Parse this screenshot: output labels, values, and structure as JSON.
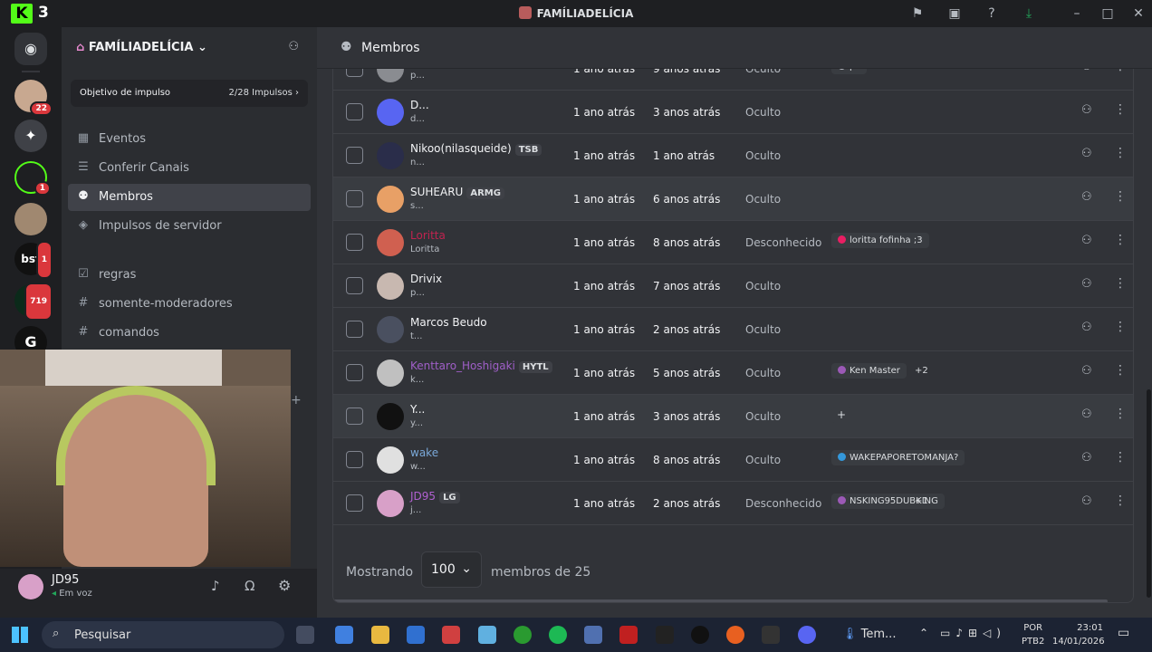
{
  "titlebar": {
    "app_logo": "K",
    "app_tab_number": "3",
    "server_title": "FAMÍLIADELÍCIA"
  },
  "servers": {
    "badges": [
      "22",
      "1",
      "1",
      "719"
    ]
  },
  "sidebar": {
    "server_name": "FAMÍLIADELÍCIA",
    "boost_goal_label": "Objetivo de impulso",
    "boost_count": "2/28 Impulsos",
    "items": [
      {
        "label": "Eventos",
        "icon": "calendar-icon"
      },
      {
        "label": "Conferir Canais",
        "icon": "list-icon"
      },
      {
        "label": "Membros",
        "icon": "members-icon"
      },
      {
        "label": "Impulsos de servidor",
        "icon": "boost-icon"
      }
    ],
    "channels": [
      {
        "label": "regras",
        "icon": "rules-icon"
      },
      {
        "label": "somente-moderadores",
        "icon": "hash-icon"
      },
      {
        "label": "comandos",
        "icon": "hash-icon"
      }
    ]
  },
  "user": {
    "name": "JD95",
    "status": "Em voz"
  },
  "main": {
    "title": "Membros"
  },
  "members": [
    {
      "name": "",
      "sub": "p...",
      "col1": "1 ano atrás",
      "col2": "9 anos atrás",
      "col3": "Oculto",
      "role": "po",
      "role_color": "#b5bac1",
      "extra": "",
      "name_color": "#f2f3f5",
      "tag": "",
      "av": "#8a8c91"
    },
    {
      "name": "D...",
      "sub": "d...",
      "col1": "1 ano atrás",
      "col2": "3 anos atrás",
      "col3": "Oculto",
      "role": "",
      "role_color": "",
      "extra": "",
      "name_color": "#f2f3f5",
      "tag": "",
      "av": "#5865f2"
    },
    {
      "name": "Nikoo(nilasqueide)",
      "sub": "n...",
      "col1": "1 ano atrás",
      "col2": "1 ano atrás",
      "col3": "Oculto",
      "role": "",
      "role_color": "",
      "extra": "",
      "name_color": "#f2f3f5",
      "tag": "TSB",
      "av": "#2a2d4a"
    },
    {
      "name": "SUHEARU",
      "sub": "s...",
      "col1": "1 ano atrás",
      "col2": "6 anos atrás",
      "col3": "Oculto",
      "role": "",
      "role_color": "",
      "extra": "",
      "name_color": "#f2f3f5",
      "tag": "ARMG",
      "av": "#e8a066"
    },
    {
      "name": "Loritta",
      "sub": "Loritta",
      "col1": "1 ano atrás",
      "col2": "8 anos atrás",
      "col3": "Desconhecido",
      "role": "loritta fofinha ;3",
      "role_color": "#e91e63",
      "extra": "",
      "name_color": "#c0234f",
      "tag": "",
      "av": "#d06050"
    },
    {
      "name": "Drivix",
      "sub": "p...",
      "col1": "1 ano atrás",
      "col2": "7 anos atrás",
      "col3": "Oculto",
      "role": "",
      "role_color": "",
      "extra": "",
      "name_color": "#f2f3f5",
      "tag": "",
      "av": "#c8b8b0"
    },
    {
      "name": "Marcos Beudo",
      "sub": "t...",
      "col1": "1 ano atrás",
      "col2": "2 anos atrás",
      "col3": "Oculto",
      "role": "",
      "role_color": "",
      "extra": "",
      "name_color": "#f2f3f5",
      "tag": "",
      "av": "#4a5060"
    },
    {
      "name": "Kenttaro_Hoshigaki",
      "sub": "k...",
      "col1": "1 ano atrás",
      "col2": "5 anos atrás",
      "col3": "Oculto",
      "role": "Ken Master",
      "role_color": "#9b59b6",
      "extra": "+2",
      "name_color": "#a05fc8",
      "tag": "HYTL",
      "av": "#c0c0c0"
    },
    {
      "name": "Y...",
      "sub": "y...",
      "col1": "1 ano atrás",
      "col2": "3 anos atrás",
      "col3": "Oculto",
      "role": "+",
      "role_color": "",
      "extra": "",
      "name_color": "#f2f3f5",
      "tag": "",
      "av": "#111111"
    },
    {
      "name": "wake",
      "sub": "w...",
      "col1": "1 ano atrás",
      "col2": "8 anos atrás",
      "col3": "Oculto",
      "role": "WAKEPAPORETOMANJA?",
      "role_color": "#3498db",
      "extra": "",
      "name_color": "#7aa8d8",
      "tag": "",
      "av": "#e0e0e0"
    },
    {
      "name": "JD95",
      "sub": "j...",
      "col1": "1 ano atrás",
      "col2": "2 anos atrás",
      "col3": "Desconhecido",
      "role": "NSKING95DUBKING",
      "role_color": "#9b59b6",
      "extra": "+1",
      "name_color": "#b060d0",
      "tag": "LG",
      "av": "#d8a0c8"
    }
  ],
  "footer": {
    "showing_label": "Mostrando",
    "page_size": "100",
    "members_label": "membros de 25"
  },
  "taskbar": {
    "search_placeholder": "Pesquisar",
    "weather": "Tem...",
    "lang_line1": "POR",
    "lang_line2": "PTB2",
    "time": "23:01",
    "date": "14/01/2026"
  }
}
